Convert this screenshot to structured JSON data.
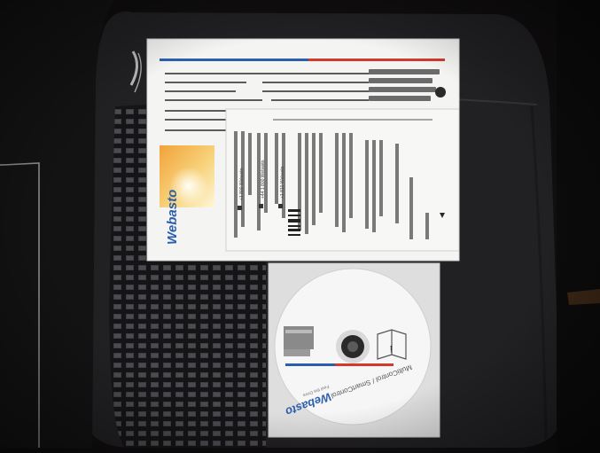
{
  "manual": {
    "brand": "Webasto",
    "phone_1": "+1 800 Webasto",
    "phone_2": "+44 1 800 Webasto",
    "phone_3": "+1 810 Webasto"
  },
  "cd": {
    "brand": "Webasto",
    "brand_tagline": "Feel the Drive",
    "title": "MultiControl / SmartControl"
  },
  "colors": {
    "brand_blue": "#2b5fae",
    "brand_red": "#d23a2c",
    "seat_fabric": "#222225",
    "pattern_block": "#55545a"
  }
}
